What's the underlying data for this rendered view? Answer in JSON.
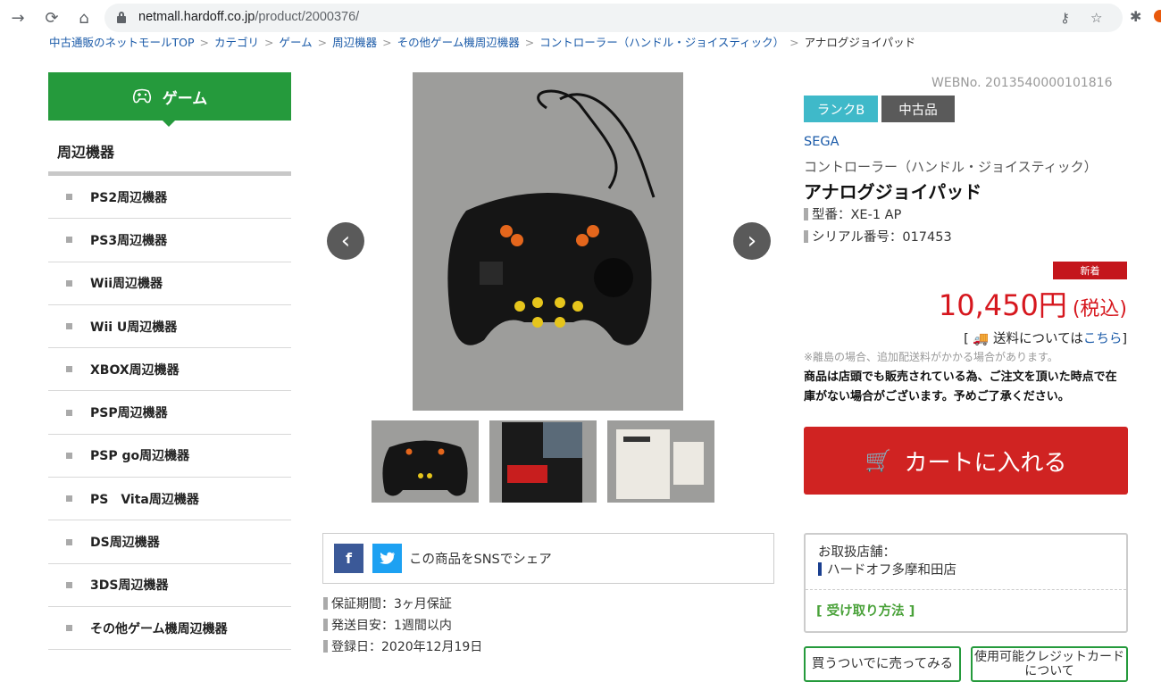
{
  "browser": {
    "url_domain": "netmall.hardoff.co.jp",
    "url_path": "/product/2000376/"
  },
  "breadcrumb": [
    "中古通販のネットモールTOP",
    "カテゴリ",
    "ゲーム",
    "周辺機器",
    "その他ゲーム機周辺機器",
    "コントローラー（ハンドル・ジョイスティック）",
    "アナログジョイパッド"
  ],
  "sidebar": {
    "category": "ゲーム",
    "subheading": "周辺機器",
    "items": [
      "PS2周辺機器",
      "PS3周辺機器",
      "Wii周辺機器",
      "Wii U周辺機器",
      "XBOX周辺機器",
      "PSP周辺機器",
      "PSP go周辺機器",
      "PS　Vita周辺機器",
      "DS周辺機器",
      "3DS周辺機器",
      "その他ゲーム機周辺機器"
    ]
  },
  "share": {
    "text": "この商品をSNSでシェア",
    "facebook": "f",
    "twitter": "t"
  },
  "info": [
    "保証期間：3ヶ月保証",
    "発送目安：1週間以内",
    "登録日：2020年12月19日"
  ],
  "product": {
    "webno": "WEBNo. 2013540000101816",
    "rank": "ランクB",
    "condition": "中古品",
    "maker": "SEGA",
    "category": "コントローラー（ハンドル・ジョイスティック）",
    "name": "アナログジョイパッド",
    "model": "型番：XE-1 AP",
    "serial": "シリアル番号：017453",
    "new_badge": "新着",
    "price": "10,450円",
    "tax": "(税込)",
    "shipping_prefix": "送料については",
    "shipping_link": "こちら",
    "note": "※離島の場合、追加配送料がかかる場合があります。",
    "warning": "商品は店頭でも販売されている為、ご注文を頂いた時点で在庫がない場合がございます。予めご了承ください。",
    "cart_label": "カートに入れる"
  },
  "store": {
    "label": "お取扱店舗：",
    "name": "ハードオフ多摩和田店",
    "pickup": "[ 受け取り方法 ]"
  },
  "bottom_buttons": [
    "買うついでに売ってみる",
    "使用可能クレジットカードについて"
  ],
  "colors": {
    "accent_green": "#259a3c",
    "cart_red": "#d02322",
    "price_red": "#d6171e",
    "rank_cyan": "#3fb9c9",
    "link_blue": "#1a5aa8"
  },
  "icons": [
    "back-arrow-icon",
    "reload-icon",
    "home-icon",
    "lock-icon",
    "key-icon",
    "star-icon",
    "extension-icon",
    "gamepad-icon",
    "cart-icon",
    "truck-icon",
    "chevron-left-icon",
    "chevron-right-icon"
  ]
}
